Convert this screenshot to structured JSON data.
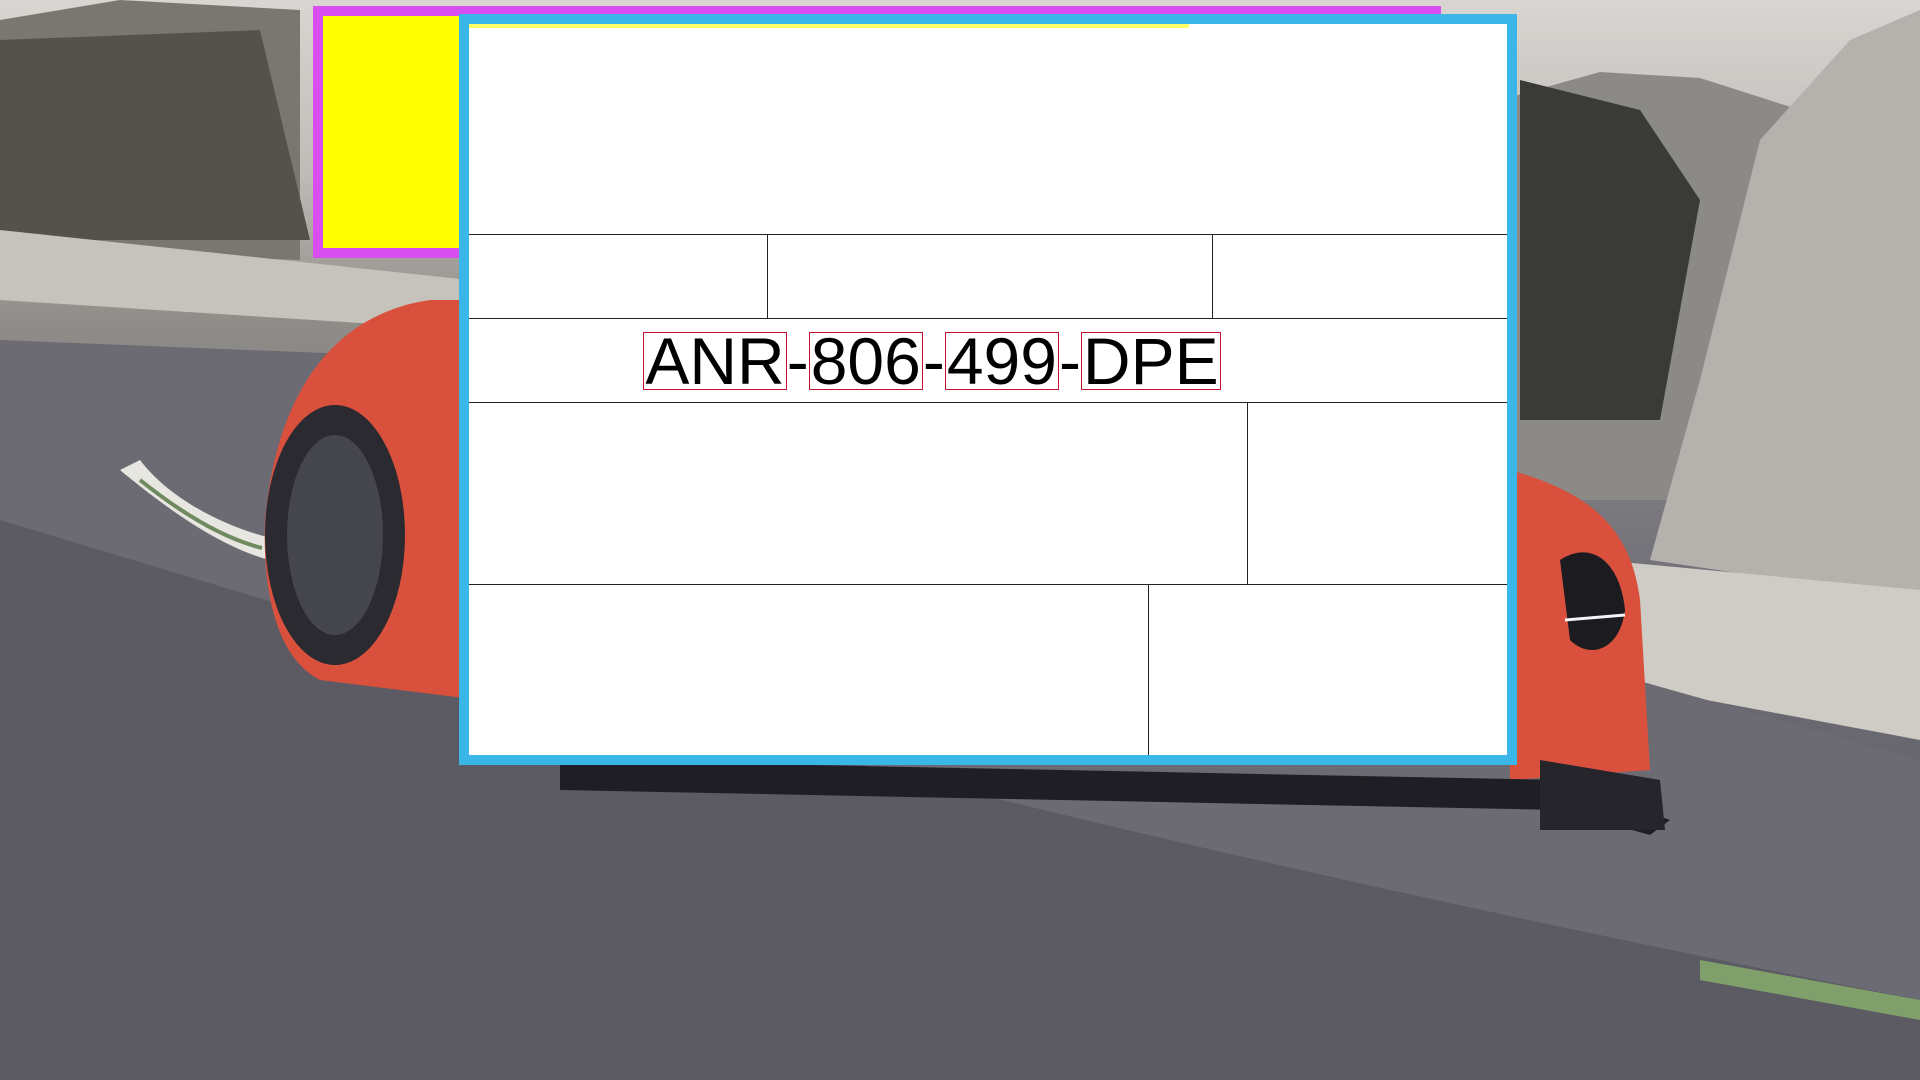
{
  "screen": {
    "background_scene": "red sports car on race track",
    "colors": {
      "back_window_border": "#d84ef0",
      "back_window_fill": "#ffff00",
      "doc_window_border": "#3bb6e8",
      "doc_window_fill": "#ffffff",
      "char_box_outline": "#c8102e"
    }
  },
  "document": {
    "plate_segments": [
      "ANR",
      "806",
      "499",
      "DPE"
    ],
    "plate_separator": "-"
  }
}
